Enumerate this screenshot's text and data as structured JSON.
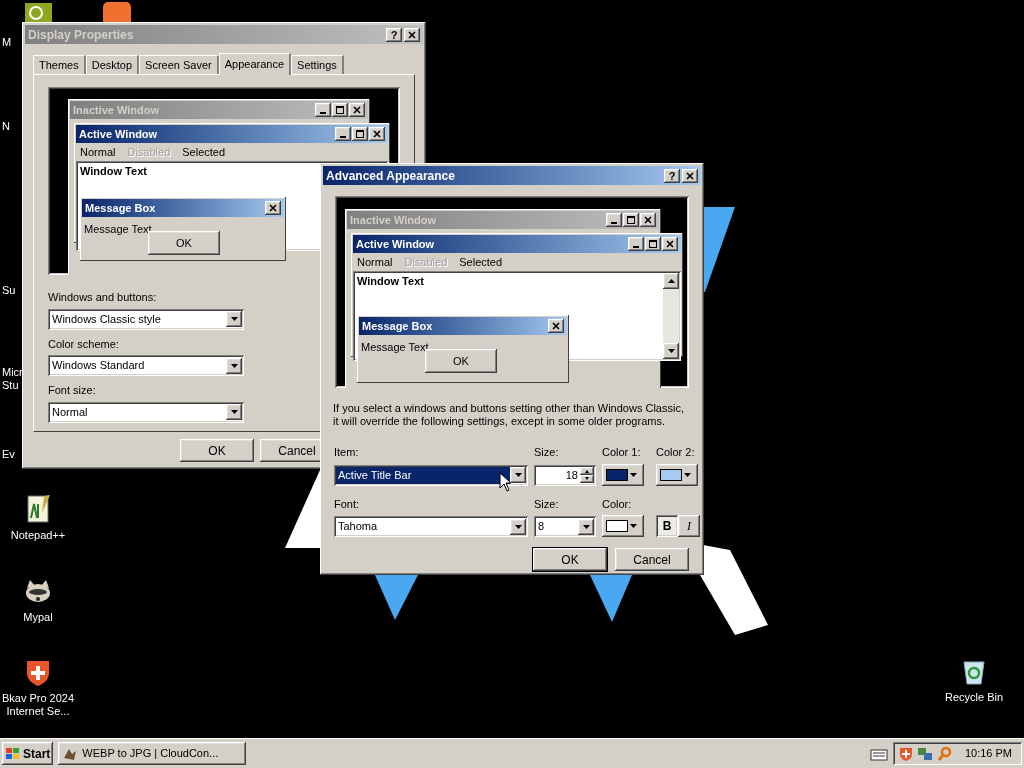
{
  "desktop": {
    "cut_labels": [
      "M",
      "N",
      "Su",
      "Micr",
      "Stu",
      "Ev"
    ],
    "icons": [
      {
        "label": "Notepad++",
        "kind": "notepad"
      },
      {
        "label": "Mypal",
        "kind": "raccoon"
      },
      {
        "label": "Bkav Pro 2024 Internet Se...",
        "kind": "shield"
      },
      {
        "label": "Recycle Bin",
        "kind": "bin"
      }
    ]
  },
  "display_properties": {
    "title": "Display Properties",
    "active": false,
    "help": "?",
    "tabs": [
      {
        "label": "Themes",
        "selected": false
      },
      {
        "label": "Desktop",
        "selected": false
      },
      {
        "label": "Screen Saver",
        "selected": false
      },
      {
        "label": "Appearance",
        "selected": true
      },
      {
        "label": "Settings",
        "selected": false
      }
    ],
    "preview": {
      "inactive_title": "Inactive Window",
      "active_title": "Active Window",
      "menu": [
        {
          "label": "Normal",
          "disabled": false
        },
        {
          "label": "Disabled",
          "disabled": true
        },
        {
          "label": "Selected",
          "disabled": false
        }
      ],
      "window_text": "Window Text",
      "message_title": "Message Box",
      "message_text": "Message Text",
      "ok": "OK"
    },
    "fields": [
      {
        "label": "Windows and buttons:",
        "value": "Windows Classic style"
      },
      {
        "label": "Color scheme:",
        "value": "Windows Standard"
      },
      {
        "label": "Font size:",
        "value": "Normal"
      }
    ],
    "buttons": [
      "OK",
      "Cancel"
    ]
  },
  "advanced": {
    "title": "Advanced Appearance",
    "active": true,
    "help": "?",
    "preview": {
      "inactive_title": "Inactive Window",
      "active_title": "Active Window",
      "menu": [
        {
          "label": "Normal",
          "disabled": false
        },
        {
          "label": "Disabled",
          "disabled": true
        },
        {
          "label": "Selected",
          "disabled": false
        }
      ],
      "window_text": "Window Text",
      "message_title": "Message Box",
      "message_text": "Message Text",
      "ok": "OK"
    },
    "note": "If you select a windows and buttons setting other than Windows Classic, it will override the following settings, except in some older programs.",
    "item": {
      "label": "Item:",
      "value": "Active Title Bar",
      "focused": true
    },
    "item_size": {
      "label": "Size:",
      "value": "18"
    },
    "colors": [
      {
        "label": "Color 1:",
        "color": "#0a246a"
      },
      {
        "label": "Color 2:",
        "color": "#a6caf0"
      }
    ],
    "font": {
      "label": "Font:",
      "value": "Tahoma",
      "focused": false
    },
    "font_size": {
      "label": "Size:",
      "value": "8"
    },
    "font_color": {
      "label": "Color:",
      "color": "#ffffff"
    },
    "bold": {
      "label": "B",
      "on": true
    },
    "italic": {
      "label": "I",
      "on": false
    },
    "buttons": [
      "OK",
      "Cancel"
    ]
  },
  "taskbar": {
    "start": "Start",
    "tasks": [
      {
        "label": "WEBP to JPG | CloudCon...",
        "selected": false
      }
    ],
    "clock": "10:16 PM"
  }
}
